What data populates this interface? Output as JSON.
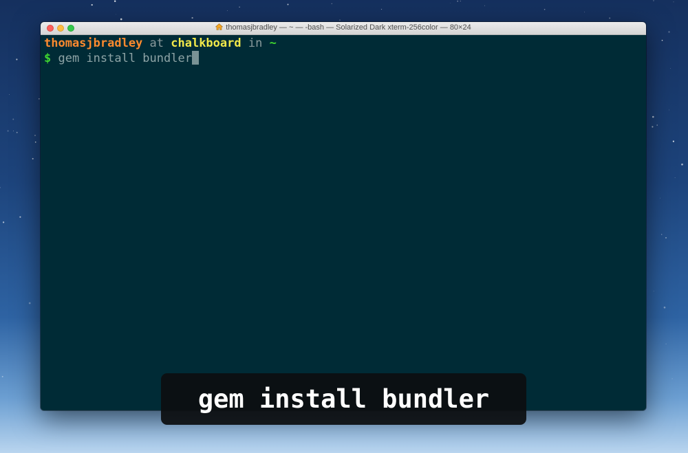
{
  "window": {
    "title": "thomasjbradley — ~ — -bash — Solarized Dark xterm-256color — 80×24",
    "title_icon": "home-icon"
  },
  "terminal": {
    "prompt_line": {
      "user": "thomasjbradley",
      "at_word": " at ",
      "host": "chalkboard",
      "in_word": " in ",
      "dir": "~"
    },
    "command_line": {
      "prompt_symbol": "$",
      "command": " gem install bundler"
    }
  },
  "caption": {
    "text": "gem install bundler"
  },
  "colors": {
    "terminal_bg": "#002b36",
    "user": "#fd8a2e",
    "host": "#f2e84a",
    "dir": "#3fd430",
    "text": "#8ea4a6"
  }
}
